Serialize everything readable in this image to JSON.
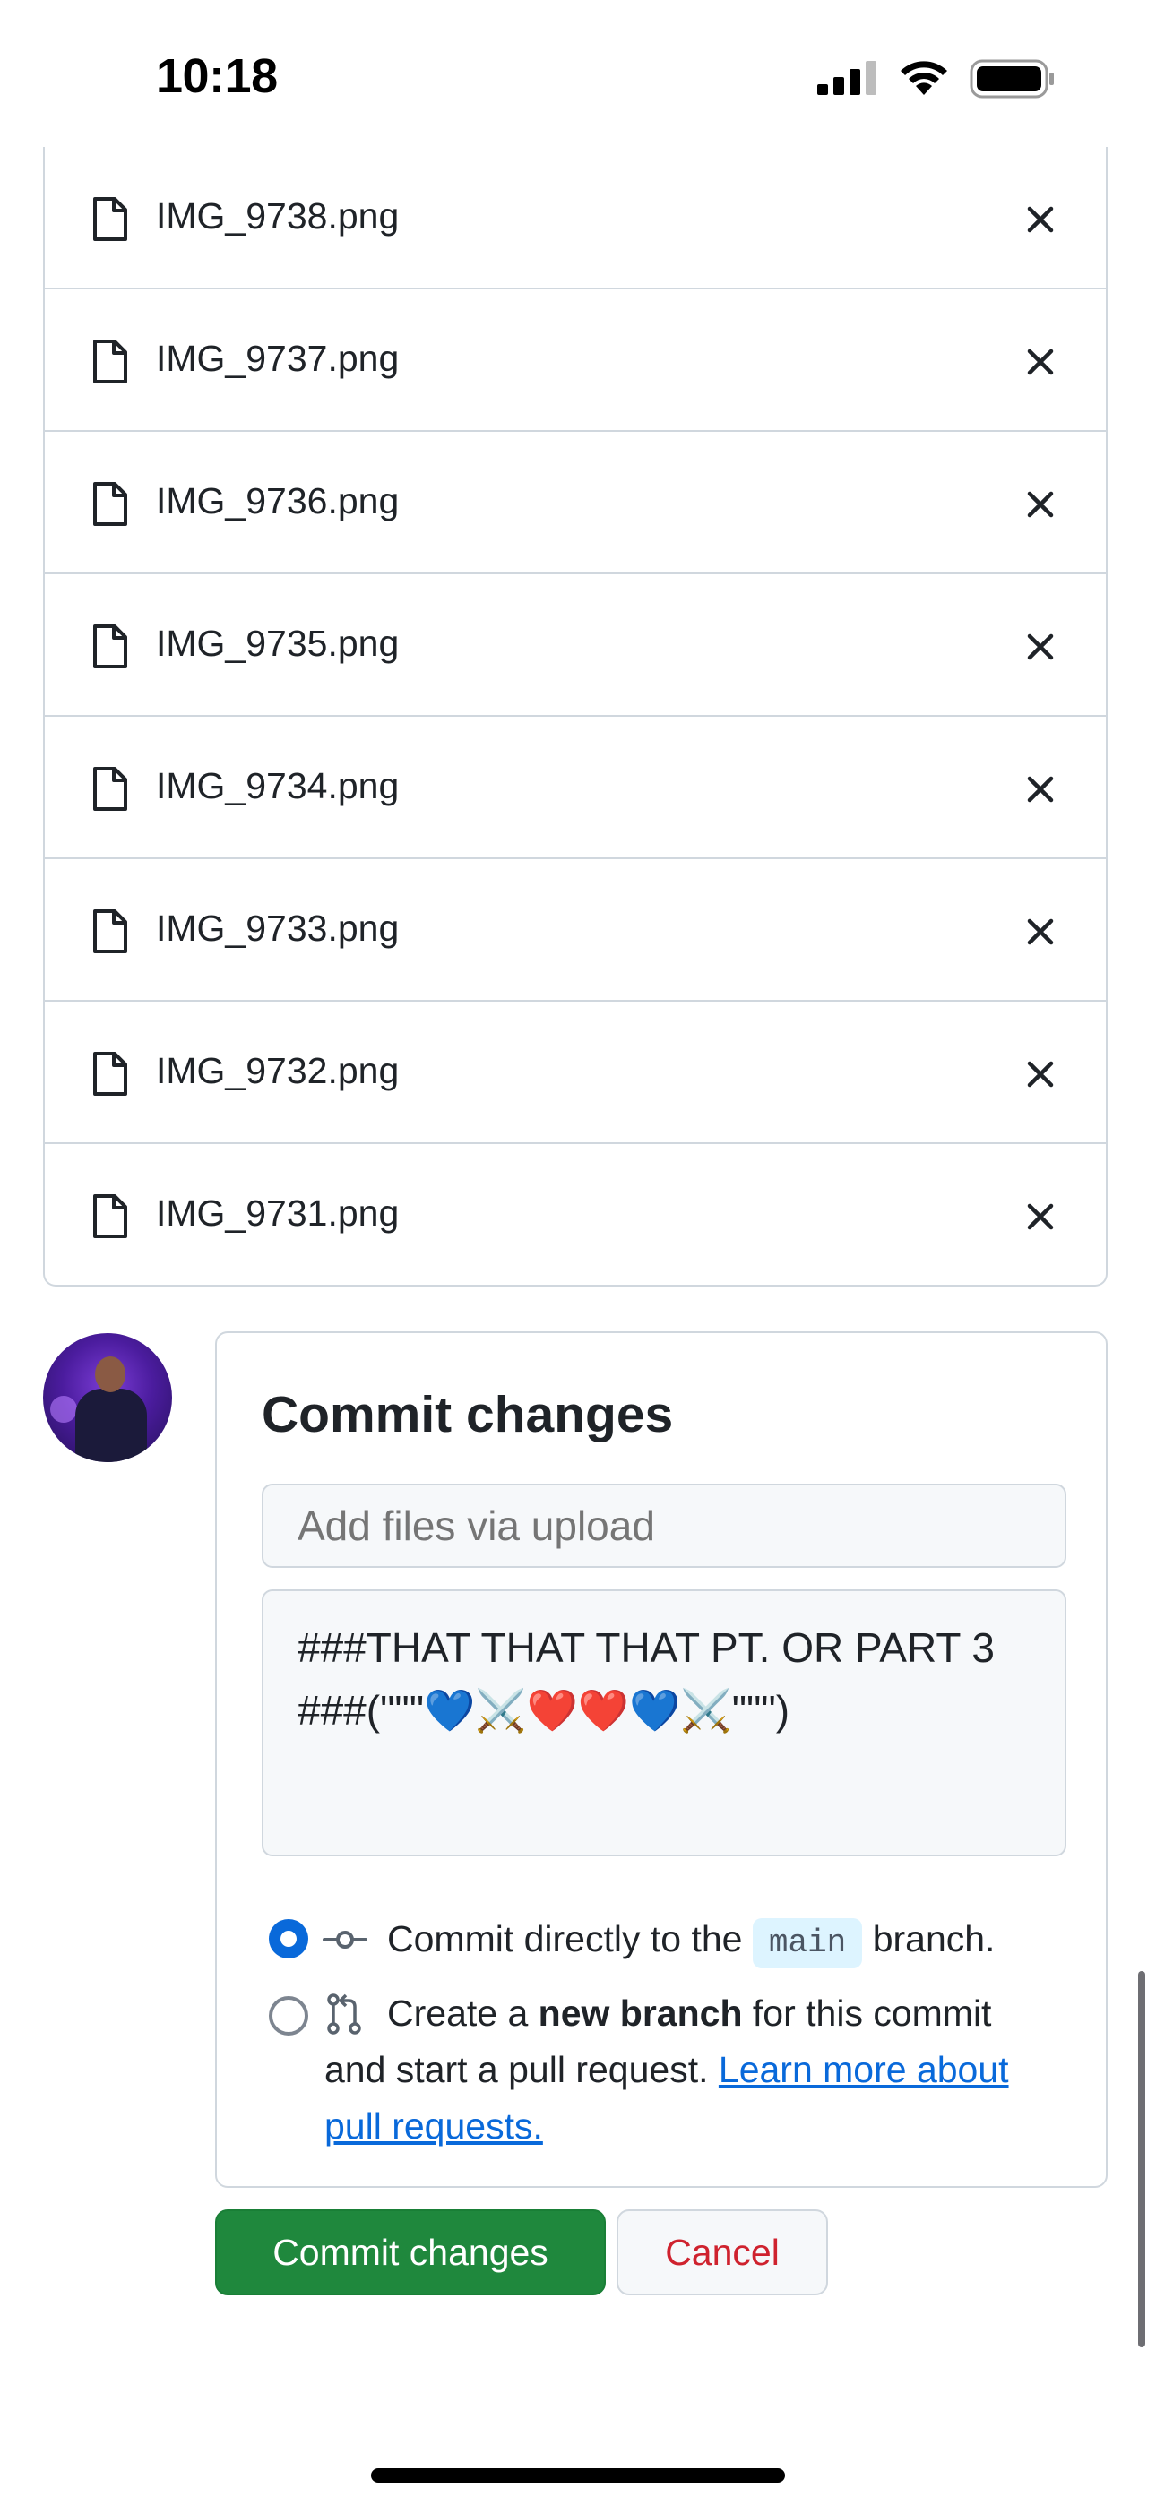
{
  "status_bar": {
    "time": "10:18"
  },
  "files": [
    {
      "name": "IMG_9738.png"
    },
    {
      "name": "IMG_9737.png"
    },
    {
      "name": "IMG_9736.png"
    },
    {
      "name": "IMG_9735.png"
    },
    {
      "name": "IMG_9734.png"
    },
    {
      "name": "IMG_9733.png"
    },
    {
      "name": "IMG_9732.png"
    },
    {
      "name": "IMG_9731.png"
    }
  ],
  "commit": {
    "title": "Commit changes",
    "summary_placeholder": "Add files via upload",
    "summary_value": "",
    "description_line1": "###THAT THAT THAT PT. OR PART 3",
    "description_line2": "###(\"\"\"💙⚔️❤️❤️💙⚔️\"\"\")",
    "option_direct": {
      "prefix": "Commit directly to the",
      "branch": "main",
      "suffix": "branch.",
      "selected": true
    },
    "option_new_branch": {
      "line1_pre": "Create a",
      "line1_bold": "new branch",
      "line1_post": "for this commit",
      "line2_text": "and start a pull request.",
      "line2_link": "Learn more about",
      "line3_link": "pull requests.",
      "selected": false
    }
  },
  "buttons": {
    "commit": "Commit changes",
    "cancel": "Cancel"
  },
  "colors": {
    "accent_blue": "#0969da",
    "commit_green": "#1f883d",
    "cancel_red": "#cf222e",
    "border": "#d0d7de"
  }
}
